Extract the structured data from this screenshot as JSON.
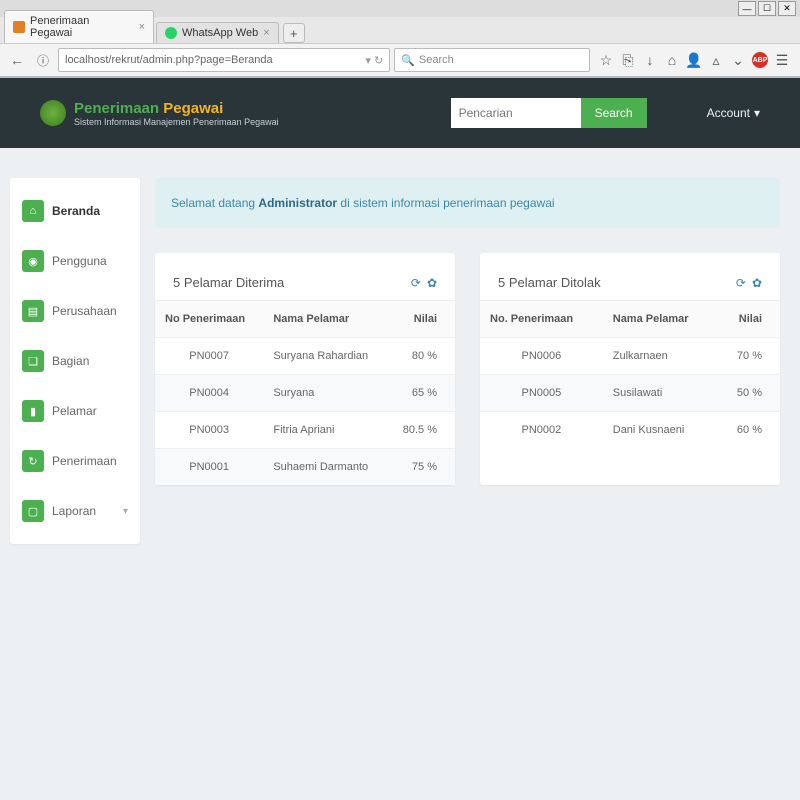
{
  "browser": {
    "tabs": [
      {
        "title": "Penerimaan Pegawai",
        "favicon_color": "#e67e22",
        "active": true
      },
      {
        "title": "WhatsApp Web",
        "favicon_color": "#25d366",
        "active": false
      }
    ],
    "url": "localhost/rekrut/admin.php?page=Beranda",
    "search_placeholder": "Search"
  },
  "app": {
    "brand1": "Penerimaan",
    "brand2": "Pegawai",
    "subtitle": "Sistem Informasi Manajemen Penerimaan Pegawai",
    "search_placeholder": "Pencarian",
    "search_button": "Search",
    "account_label": "Account"
  },
  "sidebar": [
    {
      "label": "Beranda",
      "icon": "⌂",
      "active": true
    },
    {
      "label": "Pengguna",
      "icon": "◉"
    },
    {
      "label": "Perusahaan",
      "icon": "▤"
    },
    {
      "label": "Bagian",
      "icon": "❏"
    },
    {
      "label": "Pelamar",
      "icon": "▮"
    },
    {
      "label": "Penerimaan",
      "icon": "↻"
    },
    {
      "label": "Laporan",
      "icon": "▢",
      "submenu": true
    }
  ],
  "alert": {
    "pre": "Selamat datang ",
    "strong": "Administrator",
    "post": " di sistem informasi penerimaan pegawai"
  },
  "card_diterima": {
    "title": "5 Pelamar Diterima",
    "cols": {
      "c1": "No Penerimaan",
      "c2": "Nama Pelamar",
      "c3": "Nilai"
    },
    "rows": [
      {
        "no": "PN0007",
        "nama": "Suryana Rahardian",
        "nilai": "80 %"
      },
      {
        "no": "PN0004",
        "nama": "Suryana",
        "nilai": "65 %"
      },
      {
        "no": "PN0003",
        "nama": "Fitria Apriani",
        "nilai": "80.5 %"
      },
      {
        "no": "PN0001",
        "nama": "Suhaemi Darmanto",
        "nilai": "75 %"
      }
    ]
  },
  "card_ditolak": {
    "title": "5 Pelamar Ditolak",
    "cols": {
      "c1": "No. Penerimaan",
      "c2": "Nama Pelamar",
      "c3": "Nilai"
    },
    "rows": [
      {
        "no": "PN0006",
        "nama": "Zulkarnaen",
        "nilai": "70 %"
      },
      {
        "no": "PN0005",
        "nama": "Susilawati",
        "nilai": "50 %"
      },
      {
        "no": "PN0002",
        "nama": "Dani Kusnaeni",
        "nilai": "60 %"
      }
    ]
  }
}
